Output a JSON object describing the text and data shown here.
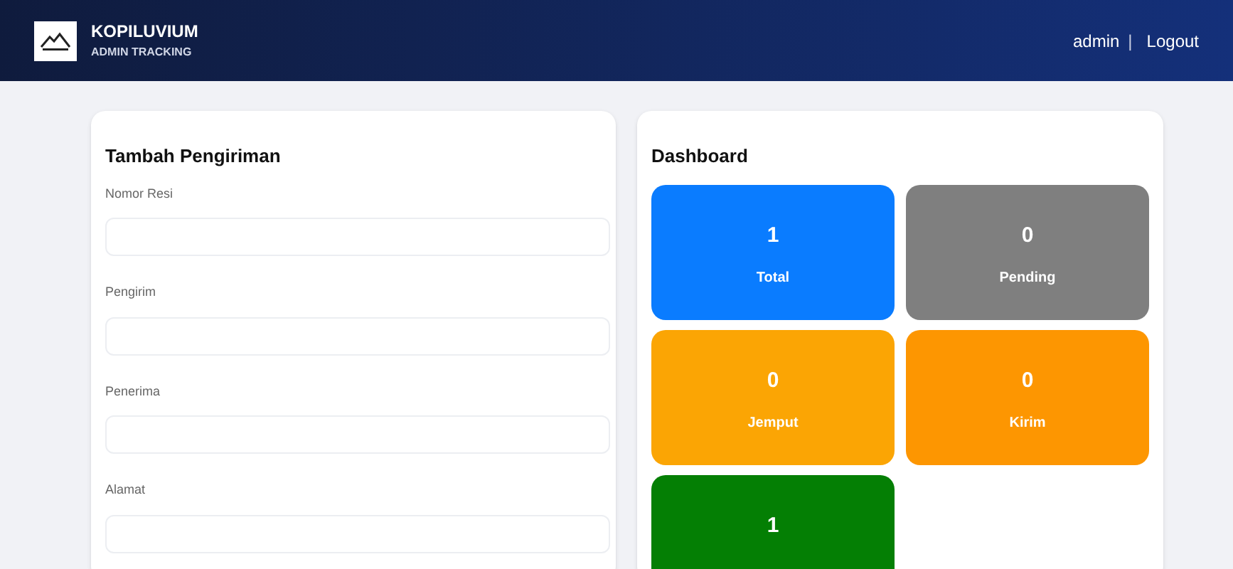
{
  "header": {
    "brand": "KOPILUVIUM",
    "subtitle": "ADMIN TRACKING",
    "user": "admin",
    "separator": "|",
    "logout": "Logout"
  },
  "form": {
    "title": "Tambah Pengiriman",
    "fields": [
      {
        "label": "Nomor Resi"
      },
      {
        "label": "Pengirim"
      },
      {
        "label": "Penerima"
      },
      {
        "label": "Alamat"
      }
    ]
  },
  "dashboard": {
    "title": "Dashboard",
    "stats": [
      {
        "value": "1",
        "label": "Total",
        "color": "#0a7cff"
      },
      {
        "value": "0",
        "label": "Pending",
        "color": "#7f7f7f"
      },
      {
        "value": "0",
        "label": "Jemput",
        "color": "#fba504"
      },
      {
        "value": "0",
        "label": "Kirim",
        "color": "#fd9601"
      },
      {
        "value": "1",
        "color": "#047f04"
      }
    ]
  }
}
